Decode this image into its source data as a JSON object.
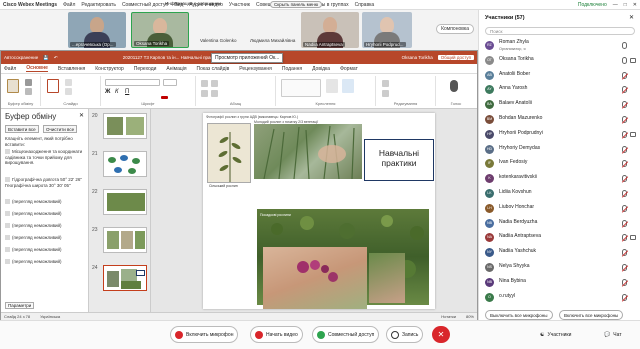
{
  "menu": {
    "app": "Cisco Webex Meetings",
    "items": [
      "Файл",
      "Редактировать",
      "Совместный доступ",
      "Вид",
      "Аудио и видео",
      "Участник",
      "Совещание",
      "Сеансы работы в группах",
      "Справка"
    ],
    "info": "Информация о совещании",
    "hide_panel": "Скрыть панель меню",
    "status": "Подключено"
  },
  "video": {
    "tiles": [
      {
        "label": "...ергачевська (Ор..."
      },
      {
        "label": "Oksana Torikha"
      },
      {
        "label": "Nadiia Antraptseva"
      },
      {
        "label": "Hryhorii Podprud..."
      }
    ],
    "names": [
      "Valentina Golenko",
      "Людмила Михайлівна"
    ],
    "layout_button": "Компоновка"
  },
  "ppt": {
    "autosave": "Автосохранение",
    "title": "20201127 Т3 Карпов та ін... Навчальні практики.pptx",
    "tooltip": "Просмотр приложений Ок...",
    "share_status": "Общий доступ",
    "user": "Oksana Torikha",
    "tabs": [
      "Файл",
      "Основне",
      "Вставлення",
      "Конструктор",
      "Переходи",
      "Анімація",
      "Показ слайдів",
      "Рецензування",
      "Подання",
      "Довідка",
      "Формат"
    ],
    "active_tab": "Основне",
    "ribbon_groups": [
      "Буфер обміну",
      "Слайди",
      "Шрифт",
      "Абзац",
      "Креслення",
      "Редагування",
      "Голос"
    ],
    "clipboard": {
      "title": "Буфер обміну",
      "paste_all": "Вставити все",
      "clear_all": "Очистити все",
      "hint": "Клацніть елемент, який потрібно вставити:",
      "items": [
        "Місцезнаходження та координати садівника та точки прийому для вирощування.",
        "Гідрографічна довгота 50° 22' 26\" Географічна широта 30° 30' 05\"",
        "(перегляд неможливий)",
        "(перегляд неможливий)",
        "(перегляд неможливий)",
        "(перегляд неможливий)",
        "(перегляд неможливий)",
        "(перегляд неможливий)"
      ],
      "params": "Параметри"
    },
    "thumb_numbers": [
      "20",
      "21",
      "22",
      "23",
      "24"
    ],
    "slide": {
      "header": "Фотографії рослин з групи АДВ (виконавець: Карпов Ю.)",
      "header2": "Молодий рослин з початку 2/3 вегетації",
      "textbox": "Навчальні практики",
      "caption1": "Сільський рослин",
      "caption2": "Посадкові рослини"
    },
    "status": {
      "slide_info": "Слайд 24 з 78",
      "lang": "Українська",
      "notes": "Нотатки",
      "zoom": "80%"
    }
  },
  "participants": {
    "header": "Участники (57)",
    "search_placeholder": "Поиск",
    "list": [
      {
        "name": "Roman Zhyla",
        "role": "Организатор, я",
        "initials": "RZ",
        "color": "#6a4c93",
        "mic": "on",
        "cam": false
      },
      {
        "name": "Oksana Torikha",
        "role": "",
        "initials": "OT",
        "color": "#8a8a8a",
        "mic": "on",
        "cam": true
      },
      {
        "name": "Anatolii Bober",
        "role": "",
        "initials": "AB",
        "color": "#5a7f9a",
        "mic": "off",
        "cam": false
      },
      {
        "name": "Anna Yarosh",
        "role": "",
        "initials": "AY",
        "color": "#3d7a5e",
        "mic": "off",
        "cam": false
      },
      {
        "name": "Balaev Anatolii",
        "role": "",
        "initials": "BA",
        "color": "#3f6b3f",
        "mic": "off",
        "cam": false
      },
      {
        "name": "Bohdan Mazurenko",
        "role": "",
        "initials": "BM",
        "color": "#7a4d3a",
        "mic": "off",
        "cam": false
      },
      {
        "name": "Hryhorii Podprudnyi",
        "role": "",
        "initials": "HP",
        "color": "#4a4a6a",
        "mic": "off",
        "cam": true
      },
      {
        "name": "Hryhoriy Demydas",
        "role": "",
        "initials": "HD",
        "color": "#5a6e87",
        "mic": "off",
        "cam": false
      },
      {
        "name": "Ivan Fedosiy",
        "role": "",
        "initials": "IF",
        "color": "#7a7a3a",
        "mic": "off",
        "cam": false
      },
      {
        "name": "kotenkaravitivskii",
        "role": "",
        "initials": "K",
        "color": "#6e3d6e",
        "mic": "off",
        "cam": false
      },
      {
        "name": "Lidiia Kovshun",
        "role": "",
        "initials": "LK",
        "color": "#3a6e6e",
        "mic": "off",
        "cam": false
      },
      {
        "name": "Liubov Honchar",
        "role": "",
        "initials": "LH",
        "color": "#8a5a2a",
        "mic": "off",
        "cam": false
      },
      {
        "name": "Nadia Berdyuzha",
        "role": "",
        "initials": "NB",
        "color": "#4a6ea0",
        "mic": "off",
        "cam": false
      },
      {
        "name": "Nadiia Antraptseva",
        "role": "",
        "initials": "NA",
        "color": "#9a3a3a",
        "mic": "off",
        "cam": true
      },
      {
        "name": "Nadiia Yashchuk",
        "role": "",
        "initials": "NY",
        "color": "#3a5a8a",
        "mic": "off",
        "cam": false
      },
      {
        "name": "Nelya Shyyka",
        "role": "",
        "initials": "NS",
        "color": "#6a6a6a",
        "mic": "off",
        "cam": false
      },
      {
        "name": "Nina Bybina",
        "role": "",
        "initials": "NB",
        "color": "#5a3a7a",
        "mic": "off",
        "cam": false
      },
      {
        "name": "o.rutyyl",
        "role": "",
        "initials": "O",
        "color": "#3a7a4a",
        "mic": "off",
        "cam": false
      }
    ],
    "mute_all": "Выключить все микрофоны",
    "unmute_all": "Включить все микрофоны"
  },
  "taskbar": {
    "mic": "Включить микрофон",
    "video": "Начать видео",
    "share": "Совместный доступ",
    "record": "Запись",
    "participants_btn": "Участники",
    "chat_btn": "Чат"
  }
}
